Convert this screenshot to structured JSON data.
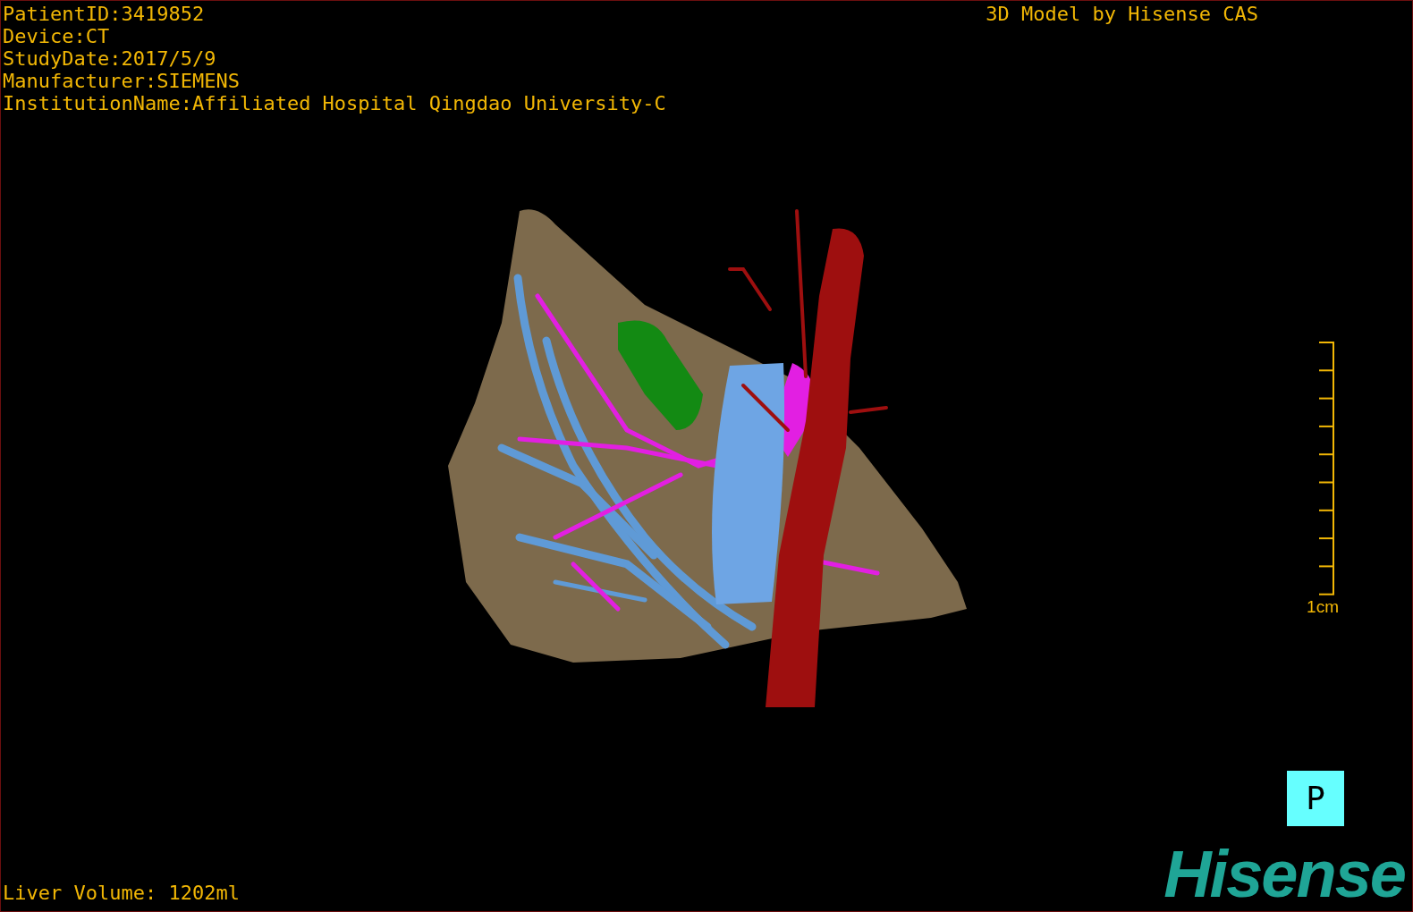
{
  "info_lines": [
    "PatientID:3419852",
    "Device:CT",
    "StudyDate:2017/5/9",
    "Manufacturer:SIEMENS",
    "InstitutionName:Affiliated Hospital Qingdao University-C"
  ],
  "title": "3D Model by Hisense CAS",
  "scale_bar": {
    "label": "1cm"
  },
  "orientation_button": {
    "label": "P"
  },
  "logo": "Hisense",
  "liver_volume": "Liver Volume: 1202ml"
}
